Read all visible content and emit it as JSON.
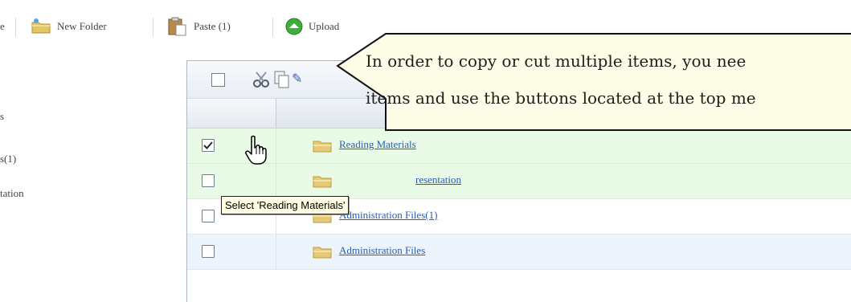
{
  "toolbar": {
    "cut_off_label": "e",
    "new_folder": "New Folder",
    "paste": "Paste (1)",
    "upload": "Upload"
  },
  "sidebar": {
    "items": [
      "s",
      "s(1)",
      "tation"
    ]
  },
  "rows": [
    {
      "name": "Reading Materials",
      "checked": true
    },
    {
      "name": "resentation",
      "checked": false
    },
    {
      "name": "Administration Files(1)",
      "checked": false
    },
    {
      "name": "Administration Files",
      "checked": false
    }
  ],
  "tooltip": "Select 'Reading Materials'",
  "callout": {
    "line1": "In order to copy or cut multiple items, you nee",
    "line2": "items and use the buttons located at the top me"
  },
  "colors": {
    "row_selected": "#e9fbe6",
    "row_alt": "#eef4fb",
    "link": "#2a5db0",
    "callout_bg": "#fdfce6"
  }
}
